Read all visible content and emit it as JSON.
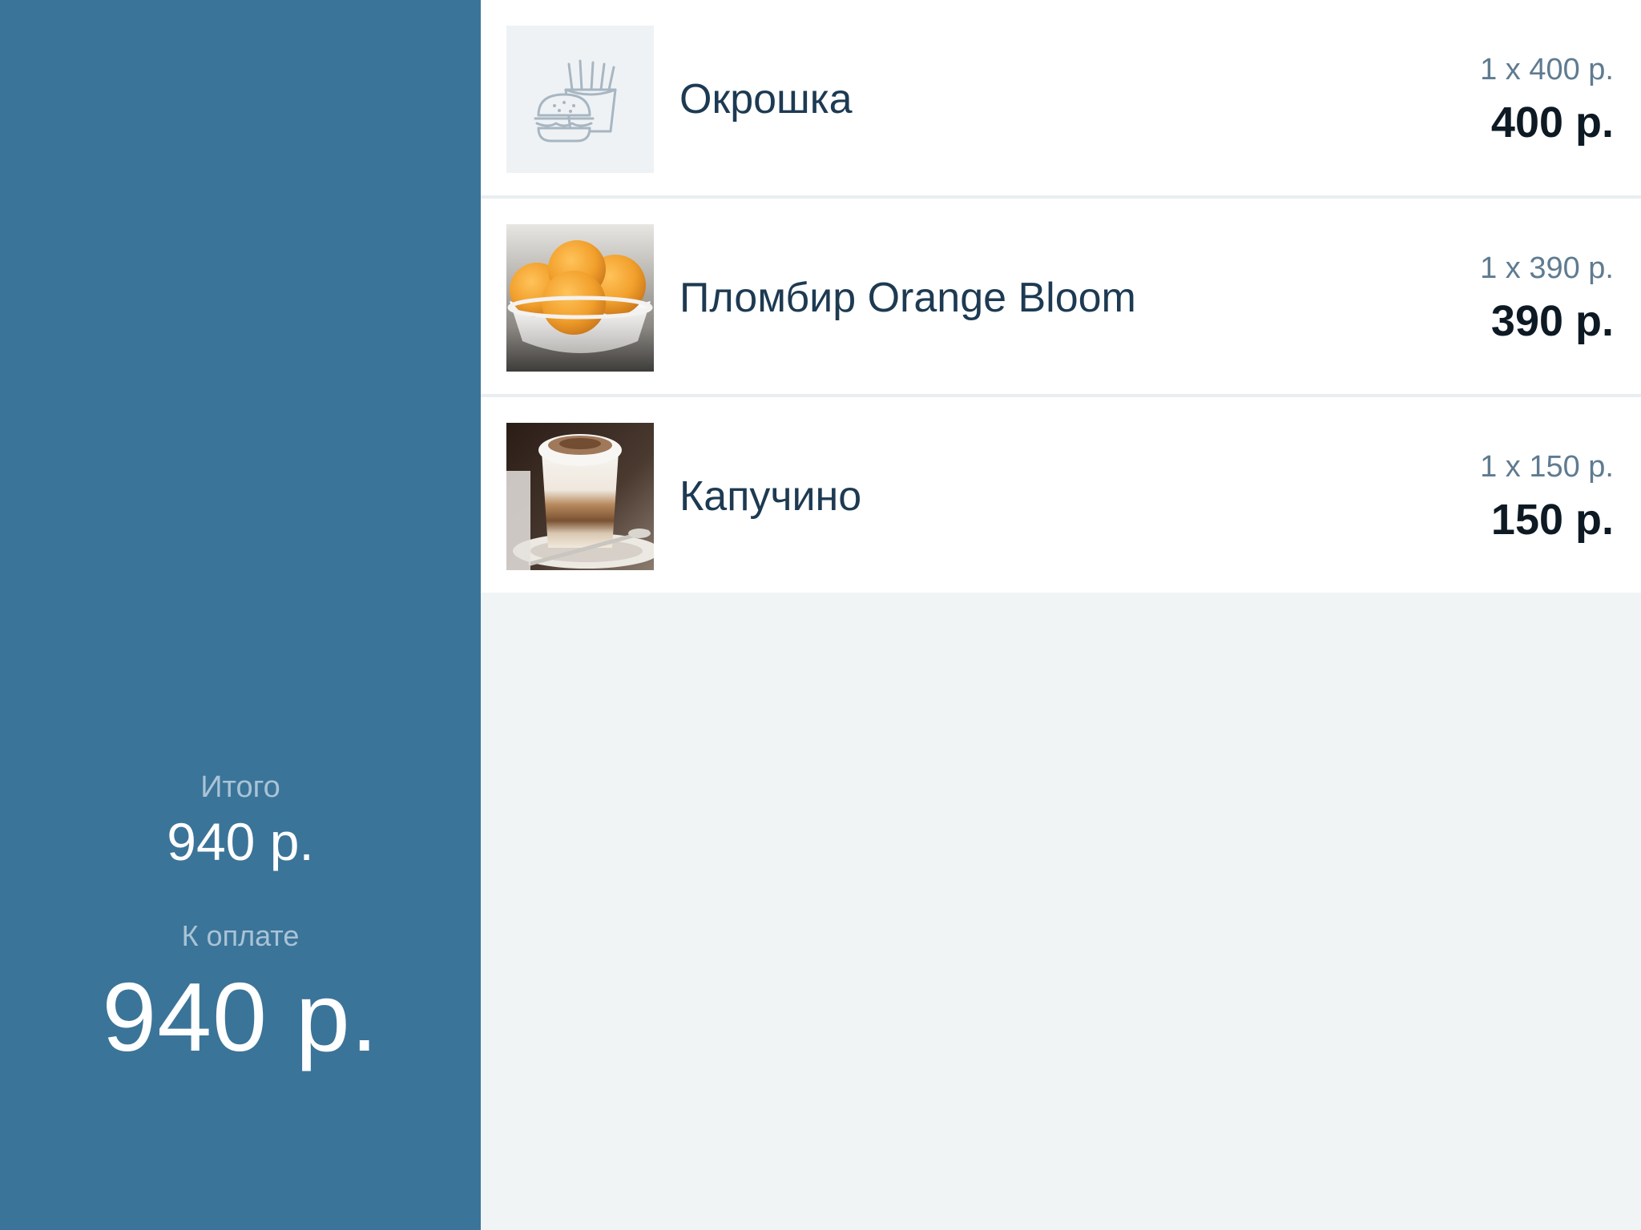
{
  "summary": {
    "total_label": "Итого",
    "total_value": "940 р.",
    "pay_label": "К оплате",
    "pay_value": "940 р."
  },
  "items": [
    {
      "name": "Окрошка",
      "qty_line": "1 x 400 р.",
      "sum": "400 р.",
      "thumb_icon": "burger-fries-icon"
    },
    {
      "name": "Пломбир Orange Bloom",
      "qty_line": "1 x 390 р.",
      "sum": "390 р.",
      "thumb_icon": "ice-cream-photo"
    },
    {
      "name": "Капучино",
      "qty_line": "1 x 150 р.",
      "sum": "150 р.",
      "thumb_icon": "cappuccino-photo"
    }
  ],
  "colors": {
    "sidebar": "#3b7499",
    "background": "#f1f4f5",
    "item_text": "#1d3a52",
    "muted": "#5f7b90"
  }
}
